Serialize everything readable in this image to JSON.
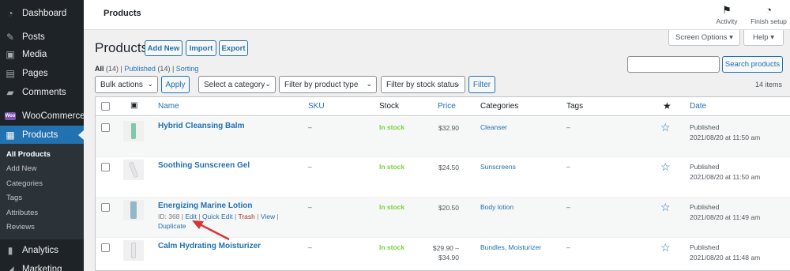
{
  "sidebar": {
    "items": [
      {
        "label": "Dashboard",
        "icon": "dashboard-icon"
      },
      {
        "label": "Posts",
        "icon": "pin-icon"
      },
      {
        "label": "Media",
        "icon": "media-icon"
      },
      {
        "label": "Pages",
        "icon": "pages-icon"
      },
      {
        "label": "Comments",
        "icon": "comments-icon"
      },
      {
        "label": "WooCommerce",
        "icon": "woocommerce-icon"
      },
      {
        "label": "Products",
        "icon": "products-icon"
      }
    ],
    "woo_badge": "Woo",
    "submenu": [
      "All Products",
      "Add New",
      "Categories",
      "Tags",
      "Attributes",
      "Reviews"
    ],
    "bottom_items": [
      {
        "label": "Analytics",
        "icon": "analytics-icon"
      },
      {
        "label": "Marketing",
        "icon": "marketing-icon"
      }
    ]
  },
  "topbar": {
    "title": "Products",
    "activity_label": "Activity",
    "finish_label": "Finish setup"
  },
  "header": {
    "title": "Products",
    "add_new": "Add New",
    "import": "Import",
    "export": "Export",
    "screen_options": "Screen Options ▾",
    "help": "Help ▾"
  },
  "filters": {
    "all": "All",
    "all_count": "(14)",
    "published": "Published",
    "published_count": "(14)",
    "sorting": "Sorting",
    "search_button": "Search products",
    "bulk_actions": "Bulk actions",
    "apply": "Apply",
    "category": "Select a category",
    "product_type": "Filter by product type",
    "stock_status": "Filter by stock status",
    "filter": "Filter",
    "items_count": "14 items"
  },
  "table": {
    "columns": {
      "name": "Name",
      "sku": "SKU",
      "stock": "Stock",
      "price": "Price",
      "categories": "Categories",
      "tags": "Tags",
      "date": "Date"
    },
    "rows": [
      {
        "name": "Hybrid Cleansing Balm",
        "sku": "–",
        "stock": "In stock",
        "price_line1": "$32.90",
        "price_line2": "",
        "categories": "Cleanser",
        "tags": "–",
        "date_status": "Published",
        "date_time": "2021/08/20 at 11:50 am",
        "thumb_color": "#7fc8a9"
      },
      {
        "name": "Soothing Sunscreen Gel",
        "sku": "–",
        "stock": "In stock",
        "price_line1": "$24.50",
        "price_line2": "",
        "categories": "Sunscreens",
        "tags": "–",
        "date_status": "Published",
        "date_time": "2021/08/20 at 11:50 am",
        "thumb_color": "#e3e4e6"
      },
      {
        "name": "Energizing Marine Lotion",
        "sku": "–",
        "stock": "In stock",
        "price_line1": "$20.50",
        "price_line2": "",
        "categories": "Body lotion",
        "tags": "–",
        "date_status": "Published",
        "date_time": "2021/08/20 at 11:49 am",
        "thumb_color": "#8fb9c7",
        "row_actions": {
          "id": "ID: 368",
          "edit": "Edit",
          "quick_edit": "Quick Edit",
          "trash": "Trash",
          "view": "View",
          "duplicate": "Duplicate"
        }
      },
      {
        "name": "Calm Hydrating Moisturizer",
        "sku": "–",
        "stock": "In stock",
        "price_line1": "$29.90 –",
        "price_line2": "$34.90",
        "categories": "Bundles, Moisturizer",
        "tags": "–",
        "date_status": "Published",
        "date_time": "2021/08/20 at 11:48 am",
        "thumb_color": "#e8e8ea"
      }
    ]
  },
  "colors": {
    "accent": "#2271b1",
    "sidebar_bg": "#1d2327",
    "in_stock": "#7ad03a",
    "annotation_arrow": "#d63638"
  }
}
